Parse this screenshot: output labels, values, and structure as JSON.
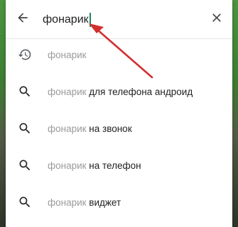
{
  "search": {
    "query": "фонарик",
    "back_icon": "arrow-back-icon",
    "clear_icon": "close-icon",
    "caret_color": "#1a8a5a"
  },
  "suggestions": [
    {
      "type": "history",
      "icon": "history-icon",
      "prefix": "фонарик",
      "rest": ""
    },
    {
      "type": "search",
      "icon": "search-icon",
      "prefix": "фонарик",
      "rest": " для телефона андроид"
    },
    {
      "type": "search",
      "icon": "search-icon",
      "prefix": "фонарик",
      "rest": " на звонок"
    },
    {
      "type": "search",
      "icon": "search-icon",
      "prefix": "фонарик",
      "rest": " на телефон"
    },
    {
      "type": "search",
      "icon": "search-icon",
      "prefix": "фонарик",
      "rest": " виджет"
    }
  ],
  "annotation": {
    "type": "red-arrow",
    "color": "#d32f2f",
    "points_to": "text-cursor"
  },
  "colors": {
    "background_green": "#4f9a3e",
    "prefix_gray": "#9a9a9a",
    "text_dark": "#202124"
  }
}
